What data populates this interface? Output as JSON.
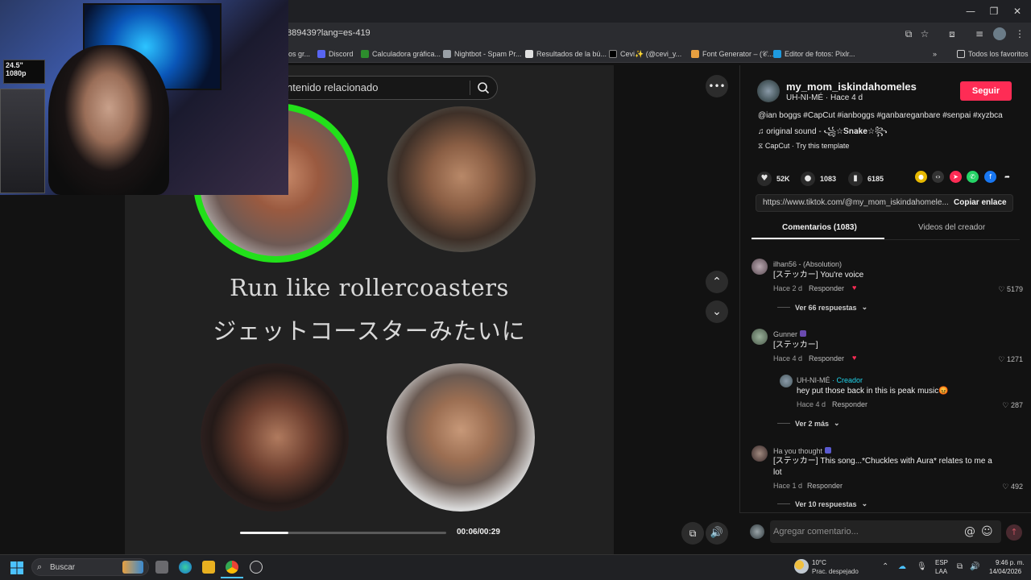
{
  "browser": {
    "url": "889439?lang=es-419",
    "bookmarks": [
      {
        "label": "os gr...",
        "color": "#8a8a8a"
      },
      {
        "label": "Discord",
        "color": "#5865f2"
      },
      {
        "label": "Calculadora gráfica...",
        "color": "#2d8d2d"
      },
      {
        "label": "Nightbot - Spam Pr...",
        "color": "#9aa0a6"
      },
      {
        "label": "Resultados de la bú...",
        "color": "#e0e0e0"
      },
      {
        "label": "Cevi✨ (@cevi_y...",
        "prefix": "✨",
        "color": "#000000"
      },
      {
        "label": "Font Generator – (𝒞...",
        "color": "#e8a040"
      },
      {
        "label": "Editor de fotos: Pixlr...",
        "color": "#1e9be0"
      }
    ],
    "all_favorites": "Todos los favoritos"
  },
  "video": {
    "search_text": "ntenido relacionado",
    "lyric_en": "Run like rollercoasters",
    "lyric_jp": "ジェットコースターみたいに",
    "progress_fraction": 0.234,
    "time": "00:06/00:29",
    "accent": "#22e01a"
  },
  "webcam": {
    "monitor_text_1": "24.5\"",
    "monitor_text_2": "1080p"
  },
  "post": {
    "author": "my_mom_iskindahomeles",
    "subline": "UH-NI-MÉ · Hace 4 d",
    "follow": "Seguir",
    "caption": "@ian boggs #CapCut #ianboggs #ganbareganbare #senpai #xyzbca",
    "sound": "original sound - ꧁☆𝐒𝐧𝐚𝐤𝐞☆꧂",
    "template": "CapCut · Try this template",
    "likes": "52K",
    "comments": "1083",
    "saves": "6185",
    "link": "https://www.tiktok.com/@my_mom_iskindahomele...",
    "copy_link": "Copiar enlace",
    "tab_comments": "Comentarios (1083)",
    "tab_videos": "Videos del creador",
    "follow_color": "#fe2c55"
  },
  "comments": [
    {
      "user": "ilhan56 - (Absolution)",
      "text": "[ステッカー] You're voice",
      "meta": "Hace 2 d",
      "reply": "Responder",
      "likes": "5179",
      "more": "Ver 66 respuestas"
    },
    {
      "user": "Gunner",
      "text": "[ステッカー]",
      "meta": "Hace 4 d",
      "reply": "Responder",
      "likes": "1271"
    },
    {
      "user": "UH-NI-MÉ",
      "creator": "· Creador",
      "text": "hey put those back in this is peak music😡",
      "meta": "Hace 4 d",
      "reply": "Responder",
      "likes": "287",
      "more": "Ver 2 más"
    },
    {
      "user": "Ha you thought",
      "text": "[ステッカー] This song...*Chuckles with Aura* relates to me a lot",
      "meta": "Hace 1 d",
      "reply": "Responder",
      "likes": "492",
      "more": "Ver 10 respuestas"
    }
  ],
  "comment_box": {
    "placeholder": "Agregar comentario..."
  },
  "taskbar": {
    "search": "Buscar",
    "temp": "10°C",
    "weather": "Prac. despejado",
    "lang1": "ESP",
    "lang2": "LAA",
    "time": "9:46 p. m.",
    "date": "14/04/2026"
  }
}
